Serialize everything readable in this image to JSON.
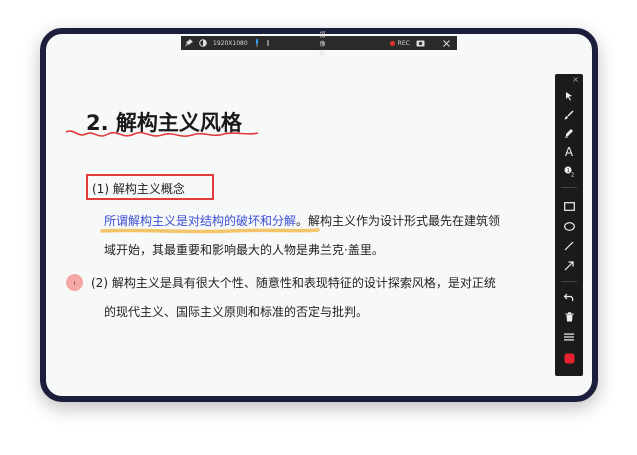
{
  "recorder_bar": {
    "resolution": "1920X1080",
    "camera_label": "摄像头",
    "rec_label": "REC"
  },
  "slide": {
    "title": "2. 解构主义风格",
    "subtitle": "(1)  解构主义概念",
    "para1_highlight": "所谓解构主义是对结构的破坏和分解",
    "para1_rest_a": "。解构主义作为设计形式最先在建筑领",
    "para1_rest_b": "域开始，其最重要和影响最大的人物是弗兰克·盖里。",
    "para2_a": "(2)  解构主义是具有很大个性、随意性和表现特征的设计探索风格，是对正统",
    "para2_b": "的现代主义、国际主义原则和标准的否定与批判。"
  },
  "toolbar": {
    "close": "×",
    "text_tool": "A"
  },
  "colors": {
    "frame": "#1c1f3b",
    "annotation_red": "#e23b3b",
    "highlight_blue": "#3a4fd6",
    "underline_yellow": "#f3c56b",
    "record_red": "#e8232f"
  }
}
